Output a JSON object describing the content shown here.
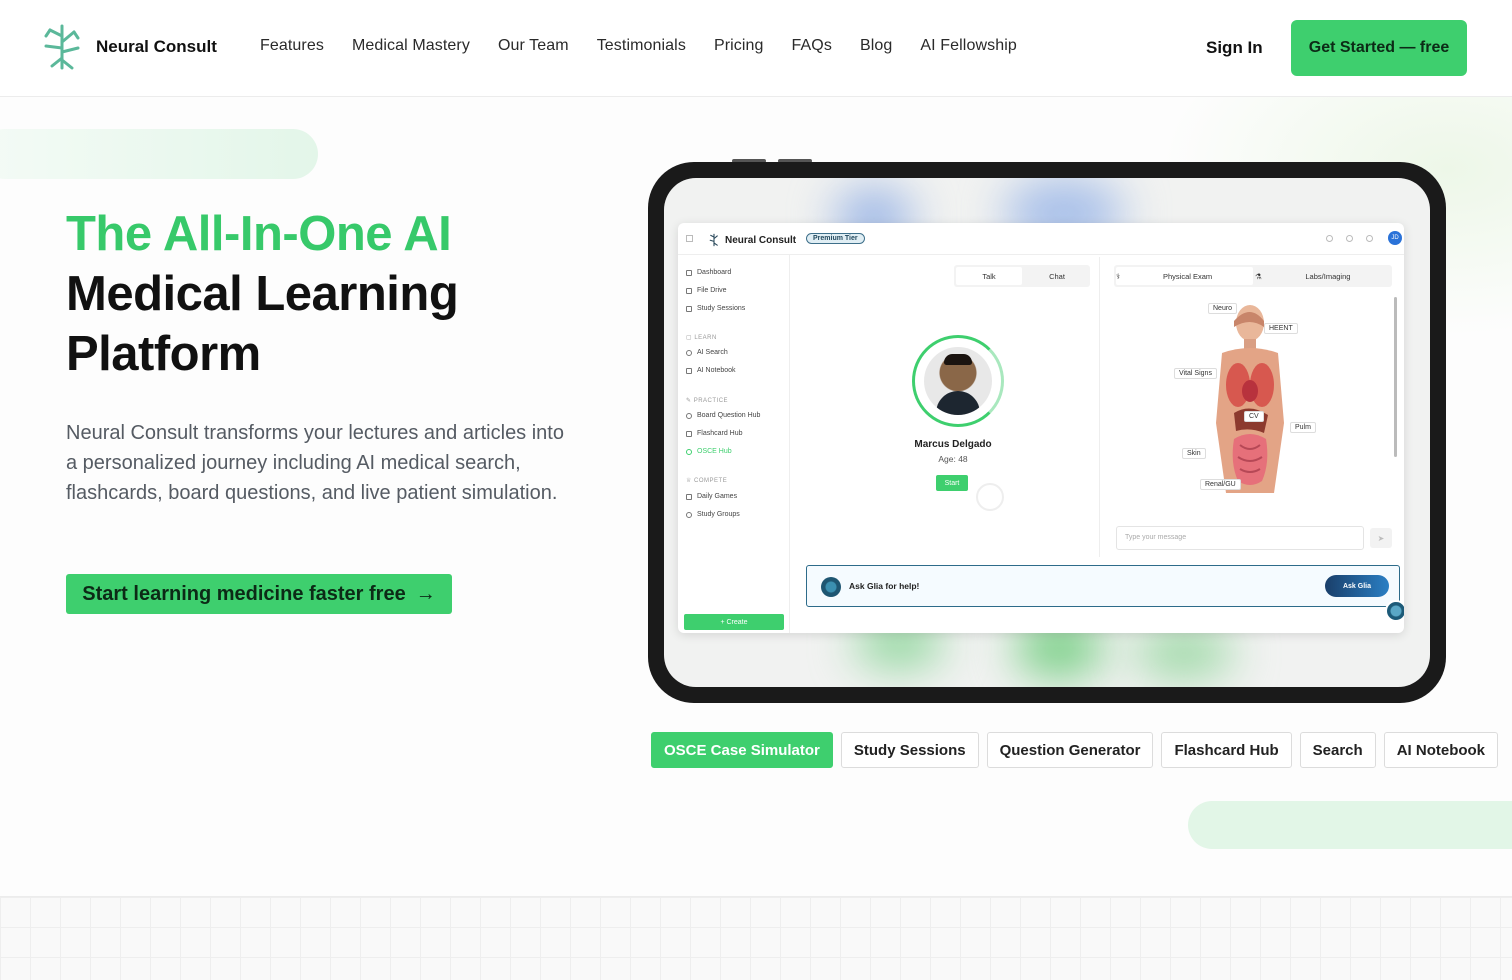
{
  "header": {
    "brand": "Neural Consult",
    "nav": [
      "Features",
      "Medical Mastery",
      "Our Team",
      "Testimonials",
      "Pricing",
      "FAQs",
      "Blog",
      "AI Fellowship"
    ],
    "signin": "Sign In",
    "cta": "Get Started — free"
  },
  "hero": {
    "title_line1": "The All-In-One AI",
    "title_line2": "Medical Learning",
    "title_line3": "Platform",
    "description": "Neural Consult transforms your lectures and articles into a personalized journey including AI medical search, flashcards, board questions, and live patient simulation.",
    "cta": "Start learning medicine faster free",
    "cta_arrow": "→"
  },
  "app": {
    "brand": "Neural Consult",
    "tier": "Premium Tier",
    "avatar": "JD",
    "sidebar": {
      "items_top": [
        "Dashboard",
        "File Drive",
        "Study Sessions"
      ],
      "section_learn": "LEARN",
      "items_learn": [
        "AI Search",
        "AI Notebook"
      ],
      "section_practice": "PRACTICE",
      "items_practice": [
        "Board Question Hub",
        "Flashcard Hub",
        "OSCE Hub"
      ],
      "section_compete": "COMPETE",
      "items_compete": [
        "Daily Games",
        "Study Groups"
      ],
      "create": "+ Create"
    },
    "sim": {
      "tab_talk": "Talk",
      "tab_chat": "Chat",
      "patient_name": "Marcus Delgado",
      "patient_age": "Age: 48",
      "start": "Start"
    },
    "exam": {
      "tab_physical": "Physical Exam",
      "tab_labs": "Labs/Imaging",
      "labels": {
        "neuro": "Neuro",
        "heent": "HEENT",
        "vital": "Vital Signs",
        "cv": "CV",
        "pulm": "Pulm",
        "skin": "Skin",
        "renal": "Renal/GU"
      },
      "input_placeholder": "Type your message",
      "send": "➤"
    },
    "glia": {
      "text": "Ask Glia for help!",
      "button": "Ask Glia"
    }
  },
  "feature_tabs": [
    "OSCE Case Simulator",
    "Study Sessions",
    "Question Generator",
    "Flashcard Hub",
    "Search",
    "AI Notebook"
  ],
  "colors": {
    "accent": "#3ecf6e",
    "title_green": "#37c96a",
    "glia_blue": "#2d6b8a"
  }
}
